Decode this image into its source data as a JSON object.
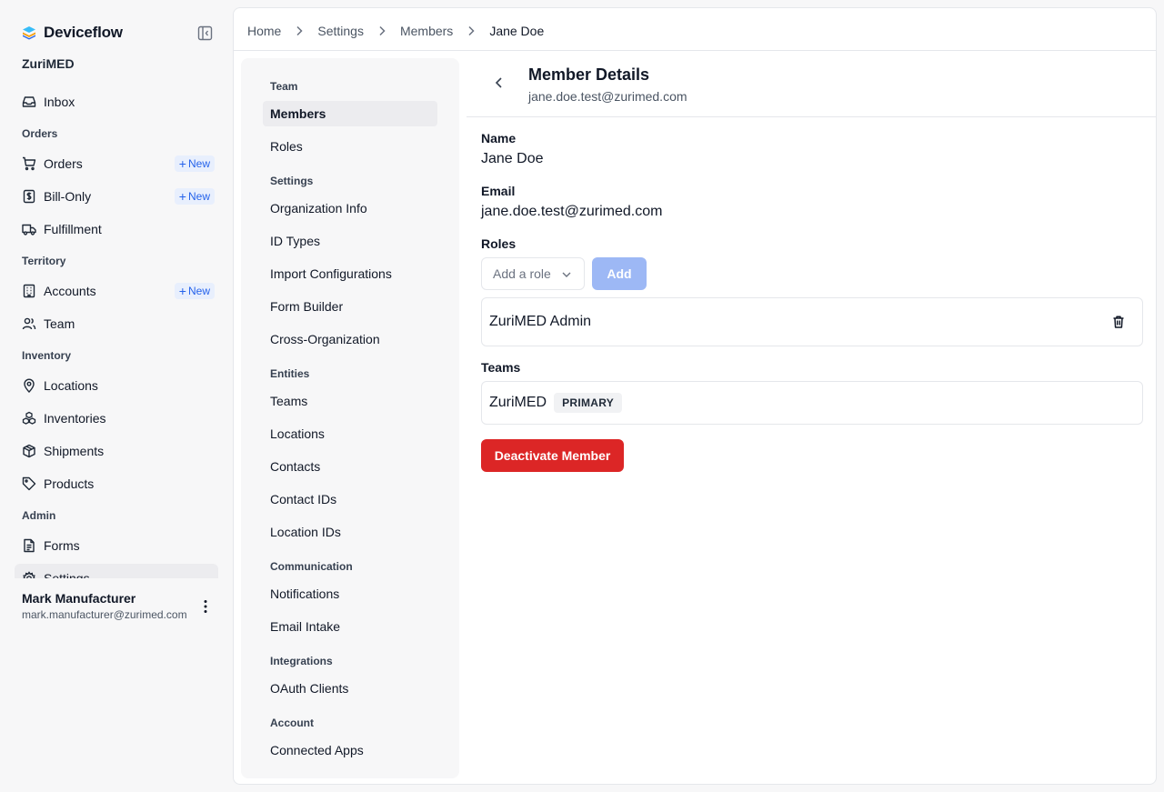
{
  "app": {
    "name": "Deviceflow",
    "org": "ZuriMED"
  },
  "sidebar": {
    "groups": {
      "orders": "Orders",
      "territory": "Territory",
      "inventory": "Inventory",
      "admin": "Admin"
    },
    "items": {
      "inbox": "Inbox",
      "orders": "Orders",
      "bill_only": "Bill-Only",
      "fulfillment": "Fulfillment",
      "accounts": "Accounts",
      "team": "Team",
      "locations": "Locations",
      "inventories": "Inventories",
      "shipments": "Shipments",
      "products": "Products",
      "forms": "Forms",
      "settings": "Settings"
    },
    "new_label": "New"
  },
  "user": {
    "name": "Mark Manufacturer",
    "email": "mark.manufacturer@zurimed.com"
  },
  "breadcrumb": {
    "home": "Home",
    "settings": "Settings",
    "members": "Members",
    "current": "Jane Doe"
  },
  "subnav": {
    "team_head": "Team",
    "members": "Members",
    "roles": "Roles",
    "settings_head": "Settings",
    "organization_info": "Organization Info",
    "id_types": "ID Types",
    "import_configurations": "Import Configurations",
    "form_builder": "Form Builder",
    "cross_organization": "Cross-Organization",
    "entities_head": "Entities",
    "teams": "Teams",
    "locations": "Locations",
    "contacts": "Contacts",
    "contact_ids": "Contact IDs",
    "location_ids": "Location IDs",
    "communication_head": "Communication",
    "notifications": "Notifications",
    "email_intake": "Email Intake",
    "integrations_head": "Integrations",
    "oauth_clients": "OAuth Clients",
    "account_head": "Account",
    "connected_apps": "Connected Apps"
  },
  "detail": {
    "title": "Member Details",
    "subtitle": "jane.doe.test@zurimed.com",
    "name_label": "Name",
    "name_value": "Jane Doe",
    "email_label": "Email",
    "email_value": "jane.doe.test@zurimed.com",
    "roles_label": "Roles",
    "role_placeholder": "Add a role",
    "add_button": "Add",
    "roles": [
      "ZuriMED Admin"
    ],
    "teams_label": "Teams",
    "team": "ZuriMED",
    "team_badge": "PRIMARY",
    "deactivate_button": "Deactivate Member"
  },
  "colors": {
    "brand_accent": "#3b82f6",
    "danger": "#dc2626",
    "disabled_primary": "#9db8f5",
    "badge_blue": "#2563eb"
  },
  "icons": {
    "logo": "deviceflow-logo-icon",
    "collapse": "sidebar-collapse-icon",
    "inbox": "inbox-icon",
    "orders": "cart-icon",
    "bill_only": "dollar-doc-icon",
    "fulfillment": "truck-icon",
    "accounts": "building-icon",
    "team": "users-icon",
    "locations": "map-pin-icon",
    "inventories": "boxes-icon",
    "shipments": "package-icon",
    "products": "tag-icon",
    "forms": "file-text-icon",
    "settings": "gear-icon",
    "back": "chevron-left-icon",
    "delete": "trash-icon"
  }
}
